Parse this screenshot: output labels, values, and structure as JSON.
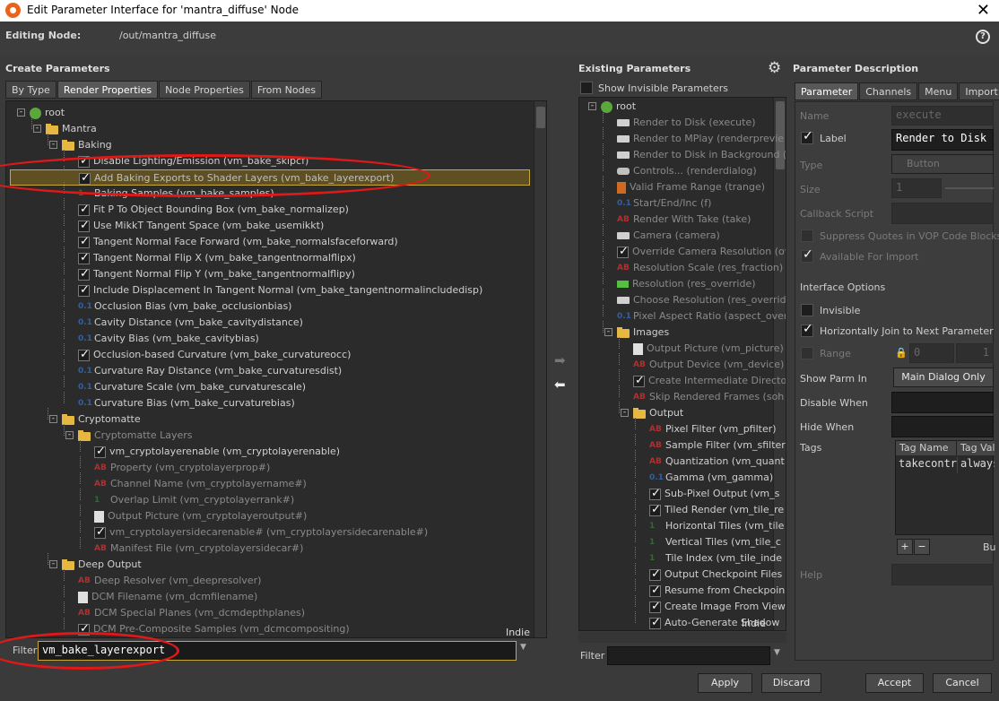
{
  "window": {
    "title": "Edit Parameter Interface for 'mantra_diffuse' Node",
    "close": "✕"
  },
  "editing": {
    "label": "Editing Node:",
    "path": "/out/mantra_diffuse",
    "help": "?"
  },
  "create": {
    "heading": "Create Parameters",
    "tabs": [
      "By Type",
      "Render Properties",
      "Node Properties",
      "From Nodes"
    ],
    "active_tab": "Render Properties",
    "tree": [
      {
        "depth": 0,
        "icon": "globe",
        "label": "root",
        "exp": "-"
      },
      {
        "depth": 1,
        "icon": "folder",
        "label": "Mantra",
        "exp": "-"
      },
      {
        "depth": 2,
        "icon": "folder",
        "label": "Baking",
        "exp": "-"
      },
      {
        "depth": 3,
        "icon": "check",
        "label": "Disable Lighting/Emission (vm_bake_skipcf)"
      },
      {
        "depth": 3,
        "icon": "check",
        "label": "Add Baking Exports to Shader Layers (vm_bake_layerexport)",
        "state": "hl"
      },
      {
        "depth": 3,
        "icon": "int",
        "label": "Baking Samples (vm_bake_samples)"
      },
      {
        "depth": 3,
        "icon": "check",
        "label": "Fit P To Object Bounding Box (vm_bake_normalizep)"
      },
      {
        "depth": 3,
        "icon": "check",
        "label": "Use MikkT Tangent Space (vm_bake_usemikkt)"
      },
      {
        "depth": 3,
        "icon": "check",
        "label": "Tangent Normal Face Forward (vm_bake_normalsfaceforward)"
      },
      {
        "depth": 3,
        "icon": "check",
        "label": "Tangent Normal Flip X (vm_bake_tangentnormalflipx)"
      },
      {
        "depth": 3,
        "icon": "check",
        "label": "Tangent Normal Flip Y (vm_bake_tangentnormalflipy)"
      },
      {
        "depth": 3,
        "icon": "check",
        "label": "Include Displacement In Tangent Normal (vm_bake_tangentnormalincludedisp)"
      },
      {
        "depth": 3,
        "icon": "float",
        "label": "Occlusion Bias (vm_bake_occlusionbias)"
      },
      {
        "depth": 3,
        "icon": "float",
        "label": "Cavity Distance (vm_bake_cavitydistance)"
      },
      {
        "depth": 3,
        "icon": "float",
        "label": "Cavity Bias (vm_bake_cavitybias)"
      },
      {
        "depth": 3,
        "icon": "check",
        "label": "Occlusion-based Curvature (vm_bake_curvatureocc)"
      },
      {
        "depth": 3,
        "icon": "float",
        "label": "Curvature Ray Distance (vm_bake_curvaturesdist)"
      },
      {
        "depth": 3,
        "icon": "float",
        "label": "Curvature Scale (vm_bake_curvaturescale)"
      },
      {
        "depth": 3,
        "icon": "float",
        "label": "Curvature Bias (vm_bake_curvaturebias)"
      },
      {
        "depth": 2,
        "icon": "folder",
        "label": "Cryptomatte",
        "exp": "-"
      },
      {
        "depth": 3,
        "icon": "folder",
        "label": "Cryptomatte Layers",
        "exp": "-",
        "state": "dim"
      },
      {
        "depth": 4,
        "icon": "check",
        "label": "vm_cryptolayerenable (vm_cryptolayerenable)"
      },
      {
        "depth": 4,
        "icon": "string",
        "label": "Property (vm_cryptolayerprop#)",
        "state": "dim"
      },
      {
        "depth": 4,
        "icon": "string",
        "label": "Channel Name (vm_cryptolayername#)",
        "state": "dim"
      },
      {
        "depth": 4,
        "icon": "int",
        "label": "Overlap Limit (vm_cryptolayerrank#)",
        "state": "dim"
      },
      {
        "depth": 4,
        "icon": "file",
        "label": "Output Picture (vm_cryptolayeroutput#)",
        "state": "dim"
      },
      {
        "depth": 4,
        "icon": "check",
        "label": "vm_cryptolayersidecarenable# (vm_cryptolayersidecarenable#)",
        "state": "dim"
      },
      {
        "depth": 4,
        "icon": "string",
        "label": "Manifest File (vm_cryptolayersidecar#)",
        "state": "dim"
      },
      {
        "depth": 2,
        "icon": "folder",
        "label": "Deep Output",
        "exp": "-"
      },
      {
        "depth": 3,
        "icon": "string",
        "label": "Deep Resolver (vm_deepresolver)",
        "state": "dim"
      },
      {
        "depth": 3,
        "icon": "file",
        "label": "DCM Filename (vm_dcmfilename)",
        "state": "dim"
      },
      {
        "depth": 3,
        "icon": "string",
        "label": "DCM Special Planes (vm_dcmdepthplanes)",
        "state": "dim"
      },
      {
        "depth": 3,
        "icon": "check",
        "label": "DCM Pre-Composite Samples (vm_dcmcompositing)",
        "state": "dim"
      }
    ],
    "indie": "Indie",
    "filter_label": "Filter",
    "filter_value": "vm_bake_layerexport"
  },
  "existing": {
    "heading": "Existing Parameters",
    "show_invisible": "Show Invisible Parameters",
    "tree": [
      {
        "depth": 0,
        "icon": "globe",
        "label": "root",
        "exp": "-"
      },
      {
        "depth": 1,
        "icon": "button",
        "label": "Render to Disk (execute)",
        "state": "dim"
      },
      {
        "depth": 1,
        "icon": "button",
        "label": "Render to MPlay (renderprevie",
        "state": "dim"
      },
      {
        "depth": 1,
        "icon": "button",
        "label": "Render to Disk in Background (e",
        "state": "dim"
      },
      {
        "depth": 1,
        "icon": "menu",
        "label": "Controls... (renderdialog)",
        "state": "dim"
      },
      {
        "depth": 1,
        "icon": "range",
        "label": "Valid Frame Range (trange)",
        "state": "dim"
      },
      {
        "depth": 1,
        "icon": "float",
        "label": "Start/End/Inc (f)",
        "state": "dim"
      },
      {
        "depth": 1,
        "icon": "string",
        "label": "Render With Take (take)",
        "state": "dim"
      },
      {
        "depth": 1,
        "icon": "button",
        "label": "Camera (camera)",
        "state": "dim"
      },
      {
        "depth": 1,
        "icon": "check",
        "label": "Override Camera Resolution (ov",
        "state": "dim"
      },
      {
        "depth": 1,
        "icon": "string",
        "label": "Resolution Scale (res_fraction)",
        "state": "dim"
      },
      {
        "depth": 1,
        "icon": "toggle",
        "label": "Resolution (res_override)",
        "state": "dim"
      },
      {
        "depth": 1,
        "icon": "button",
        "label": "Choose Resolution (res_overrid",
        "state": "dim"
      },
      {
        "depth": 1,
        "icon": "float",
        "label": "Pixel Aspect Ratio (aspect_over",
        "state": "dim"
      },
      {
        "depth": 1,
        "icon": "folder",
        "label": "Images",
        "exp": "-"
      },
      {
        "depth": 2,
        "icon": "file",
        "label": "Output Picture (vm_picture)",
        "state": "dim"
      },
      {
        "depth": 2,
        "icon": "string",
        "label": "Output Device (vm_device)",
        "state": "dim"
      },
      {
        "depth": 2,
        "icon": "check",
        "label": "Create Intermediate Directo",
        "state": "dim"
      },
      {
        "depth": 2,
        "icon": "string",
        "label": "Skip Rendered Frames (soh",
        "state": "dim"
      },
      {
        "depth": 2,
        "icon": "folder",
        "label": "Output",
        "exp": "-"
      },
      {
        "depth": 3,
        "icon": "string",
        "label": "Pixel Filter (vm_pfilter)"
      },
      {
        "depth": 3,
        "icon": "string",
        "label": "Sample Filter (vm_sfilter"
      },
      {
        "depth": 3,
        "icon": "string",
        "label": "Quantization (vm_quant"
      },
      {
        "depth": 3,
        "icon": "float",
        "label": "Gamma (vm_gamma)"
      },
      {
        "depth": 3,
        "icon": "check",
        "label": "Sub-Pixel Output (vm_s"
      },
      {
        "depth": 3,
        "icon": "check",
        "label": "Tiled Render (vm_tile_re"
      },
      {
        "depth": 3,
        "icon": "int",
        "label": "Horizontal Tiles (vm_tile"
      },
      {
        "depth": 3,
        "icon": "int",
        "label": "Vertical Tiles (vm_tile_c"
      },
      {
        "depth": 3,
        "icon": "int",
        "label": "Tile Index (vm_tile_inde"
      },
      {
        "depth": 3,
        "icon": "check",
        "label": "Output Checkpoint Files"
      },
      {
        "depth": 3,
        "icon": "check",
        "label": "Resume from Checkpoin"
      },
      {
        "depth": 3,
        "icon": "check",
        "label": "Create Image From View"
      },
      {
        "depth": 3,
        "icon": "check",
        "label": "Auto-Generate Shadow"
      }
    ],
    "indie": "Indie",
    "filter_label": "Filter",
    "filter_value": ""
  },
  "desc": {
    "heading": "Parameter Description",
    "tabs": [
      "Parameter",
      "Channels",
      "Menu",
      "Import"
    ],
    "active_tab": "Parameter",
    "name_label": "Name",
    "name_value": "execute",
    "label_label": "Label",
    "label_value": "Render to Disk",
    "type_label": "Type",
    "type_value": "Button",
    "size_label": "Size",
    "size_value": "1",
    "callback_label": "Callback Script",
    "suppress_label": "Suppress Quotes in VOP Code Blocks",
    "available_label": "Available For Import",
    "interface_options": "Interface Options",
    "invisible_label": "Invisible",
    "hjoin_label": "Horizontally Join to Next Parameter",
    "range_label": "Range",
    "range_min": "0",
    "range_max": "1",
    "show_parm_label": "Show Parm In",
    "show_parm_value": "Main Dialog Only",
    "disable_when": "Disable When",
    "hide_when": "Hide When",
    "tags_label": "Tags",
    "tag_headers": [
      "Tag Name",
      "Tag Valu"
    ],
    "tag_row": [
      "takecontr",
      "always"
    ],
    "plus": "+",
    "minus": "−",
    "bu": "Bu",
    "help_label": "Help"
  },
  "buttons": {
    "apply": "Apply",
    "discard": "Discard",
    "accept": "Accept",
    "cancel": "Cancel"
  },
  "colors": {
    "annotation": "#e01818",
    "highlight": "#5e5022"
  }
}
